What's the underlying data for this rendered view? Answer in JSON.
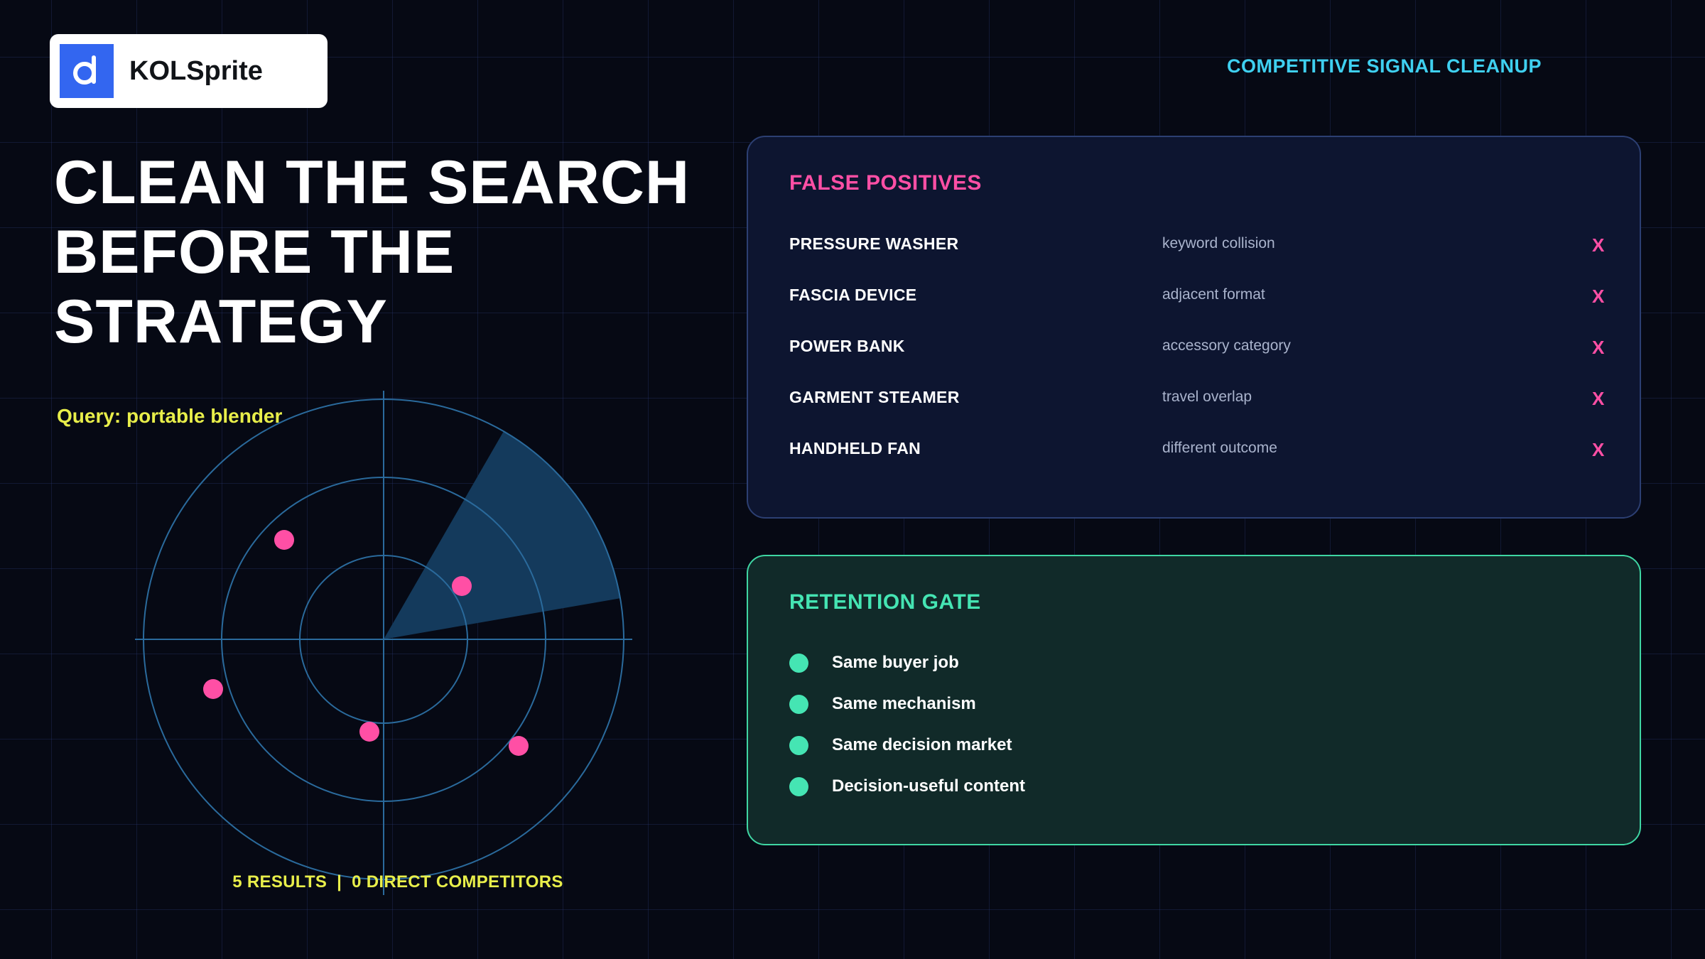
{
  "brand": {
    "name": "KOLSprite",
    "logo_icon": "kolsprite-logo-icon"
  },
  "top_tag": "COMPETITIVE SIGNAL CLEANUP",
  "headline": [
    "CLEAN THE SEARCH",
    "BEFORE THE",
    "STRATEGY"
  ],
  "query": "Query: portable blender",
  "radar": {
    "caption": "5 RESULTS  |  0 DIRECT COMPETITORS",
    "point_color": "#ff4fa5",
    "sweep_color": "#143a5c",
    "ring_color": "#2a6a9c"
  },
  "false_positives": {
    "title": "FALSE POSITIVES",
    "mark": "X",
    "items": [
      {
        "name": "PRESSURE WASHER",
        "reason": "keyword collision"
      },
      {
        "name": "FASCIA DEVICE",
        "reason": "adjacent format"
      },
      {
        "name": "POWER BANK",
        "reason": "accessory category"
      },
      {
        "name": "GARMENT STEAMER",
        "reason": "travel overlap"
      },
      {
        "name": "HANDHELD FAN",
        "reason": "different outcome"
      }
    ]
  },
  "retention_gate": {
    "title": "RETENTION GATE",
    "items": [
      "Same buyer job",
      "Same mechanism",
      "Same decision market",
      "Decision-useful content"
    ]
  },
  "colors": {
    "background": "#060914",
    "accent_cyan": "#3fd0f0",
    "accent_yellow": "#e8ee4a",
    "accent_pink": "#ff4fa5",
    "accent_green": "#45e5b3",
    "logo_blue": "#3366f0"
  }
}
